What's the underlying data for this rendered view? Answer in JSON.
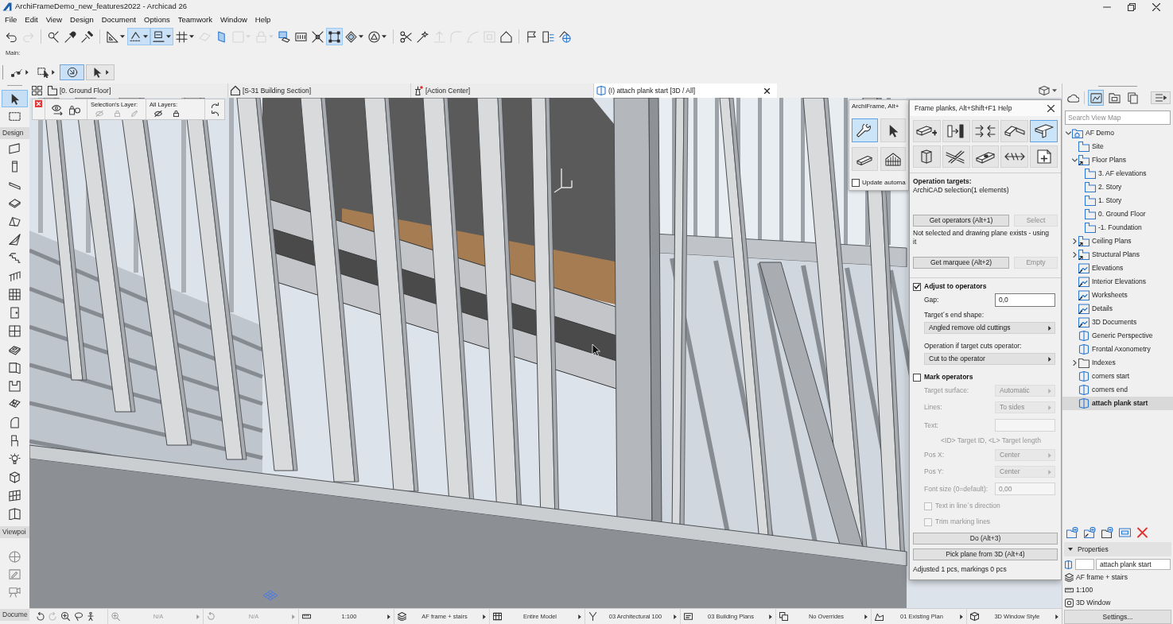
{
  "window": {
    "title": "ArchiFrameDemo_new_features2022 - Archicad 26"
  },
  "menu": [
    "File",
    "Edit",
    "View",
    "Design",
    "Document",
    "Options",
    "Teamwork",
    "Window",
    "Help"
  ],
  "toolbar": [
    {
      "selected": false,
      "disabled": false
    },
    {
      "selected": false,
      "disabled": true
    },
    {
      "selected": false,
      "disabled": false
    },
    {
      "selected": false,
      "disabled": false
    },
    {
      "selected": false,
      "disabled": false
    },
    {
      "selected": false,
      "disabled": false
    },
    {
      "selected": true,
      "disabled": false
    },
    {
      "selected": true,
      "disabled": false
    },
    {
      "selected": false,
      "disabled": false
    },
    {
      "selected": false,
      "disabled": true
    },
    {
      "selected": false,
      "disabled": false
    },
    {
      "selected": false,
      "disabled": true
    },
    {
      "selected": false,
      "disabled": true
    },
    {
      "selected": false,
      "disabled": false
    },
    {
      "selected": false,
      "disabled": false
    },
    {
      "selected": false,
      "disabled": false
    },
    {
      "selected": true,
      "disabled": false
    },
    {
      "selected": false,
      "disabled": false
    },
    {
      "selected": false,
      "disabled": false
    },
    {
      "selected": false,
      "disabled": false
    },
    {
      "selected": false,
      "disabled": false
    },
    {
      "selected": false,
      "disabled": true
    },
    {
      "selected": false,
      "disabled": true
    },
    {
      "selected": false,
      "disabled": true
    },
    {
      "selected": false,
      "disabled": true
    },
    {
      "selected": false,
      "disabled": false
    },
    {
      "selected": false,
      "disabled": false
    },
    {
      "selected": false,
      "disabled": false
    },
    {
      "selected": false,
      "disabled": false
    }
  ],
  "secondary_toolbar": {
    "label": "Main:",
    "buttons": [
      {
        "selected": false
      },
      {
        "selected": false
      },
      {
        "selected": true
      },
      {
        "selected": false
      }
    ]
  },
  "toolbox": {
    "top_tools": [
      {
        "selected": true
      },
      {
        "selected": false
      }
    ],
    "sections": [
      {
        "label": "Design",
        "tools": [
          {
            "selected": false
          },
          {
            "selected": false
          },
          {
            "selected": false
          },
          {
            "selected": false
          },
          {
            "selected": false
          },
          {
            "selected": false
          },
          {
            "selected": false
          },
          {
            "selected": false
          },
          {
            "selected": false
          },
          {
            "selected": false
          },
          {
            "selected": false
          },
          {
            "selected": false
          },
          {
            "selected": false
          },
          {
            "selected": false
          },
          {
            "selected": false
          },
          {
            "selected": false
          },
          {
            "selected": false
          },
          {
            "selected": false
          },
          {
            "selected": false
          },
          {
            "selected": false
          },
          {
            "selected": false
          }
        ]
      },
      {
        "label": "Viewpoi",
        "tools": [
          {
            "selected": false
          },
          {
            "selected": false
          },
          {
            "selected": false
          }
        ]
      },
      {
        "label": "Docume"
      }
    ]
  },
  "tabs": [
    {
      "kind": "plan",
      "label": "[0. Ground Floor]",
      "selected": false
    },
    {
      "kind": "section",
      "label": "[S-31 Building Section]",
      "selected": false
    },
    {
      "kind": "action",
      "label": "[Action Center]",
      "selected": false
    },
    {
      "kind": "model",
      "label": "(I) attach plank start [3D / All]",
      "selected": true
    }
  ],
  "layer_palette": {
    "selection_layer_label": "Selection's Layer:",
    "all_layers_label": "All Layers:"
  },
  "archiframe_palette": {
    "title": "ArchiFrame, Alt+",
    "tools": [
      {
        "selected": true
      },
      {
        "selected": false
      },
      {
        "selected": false
      },
      {
        "selected": false
      }
    ],
    "update_label": "Update automa",
    "update_checked": false
  },
  "frame_planks_dialog": {
    "title": "Frame planks, Alt+Shift+F1 Help",
    "tools": [
      {
        "selected": false
      },
      {
        "selected": false
      },
      {
        "selected": false
      },
      {
        "selected": false
      },
      {
        "selected": true
      },
      {
        "selected": false
      },
      {
        "selected": false
      },
      {
        "selected": false
      },
      {
        "selected": false
      },
      {
        "selected": false
      }
    ],
    "operation_targets_label": "Operation targets:",
    "operation_targets_value": "ArchiCAD selection(1 elements)",
    "target_buttons": [
      {
        "label": "Get operators (Alt+1)",
        "disabled": false
      },
      {
        "label": "Select",
        "disabled": true
      }
    ],
    "operators_status": "Not selected and drawing plane exists - using it",
    "marquee_buttons": [
      {
        "label": "Get marquee (Alt+2)",
        "disabled": false
      },
      {
        "label": "Empty",
        "disabled": true
      }
    ],
    "adjust": {
      "label": "Adjust to operators",
      "checked": true,
      "gap_label": "Gap:",
      "gap_value": "0,0",
      "end_shape_label": "Target´s end shape:",
      "end_shape_value": "Angled remove old cuttings",
      "cut_label": "Operation if target cuts operator:",
      "cut_value": "Cut to the operator"
    },
    "mark": {
      "label": "Mark operators",
      "checked": false,
      "fields": [
        {
          "kind": "dropdown",
          "label": "Target surface:",
          "value": "Automatic",
          "disabled": true
        },
        {
          "kind": "dropdown",
          "label": "Lines:",
          "value": "To sides",
          "disabled": true
        },
        {
          "kind": "input",
          "label": "Text:",
          "disabled": true
        },
        {
          "kind": "note",
          "label": "<ID> Target ID, <L> Target length",
          "disabled": true
        },
        {
          "kind": "dropdown",
          "label": "Pos X:",
          "value": "Center",
          "disabled": true
        },
        {
          "kind": "dropdown",
          "label": "Pos Y:",
          "value": "Center",
          "disabled": true
        },
        {
          "kind": "input",
          "label": "Font size (0=default):",
          "value": "0,00",
          "disabled": true
        },
        {
          "kind": "checkbox",
          "label": "Text in line´s direction",
          "checked": false,
          "disabled": true
        },
        {
          "kind": "checkbox",
          "label": "Trim marking lines",
          "checked": false,
          "disabled": true
        }
      ]
    },
    "do_button": "Do (Alt+3)",
    "pick_button": "Pick plane from 3D (Alt+4)",
    "result": "Adjusted 1 pcs, markings 0 pcs"
  },
  "navigator": {
    "modes": [
      {
        "selected": false
      },
      {
        "selected": true
      },
      {
        "selected": false
      },
      {
        "selected": false
      }
    ],
    "search": {
      "placeholder": "Search View Map"
    },
    "tree": [
      {
        "kind": "project",
        "label": "AF Demo",
        "expanded": true,
        "selected": false,
        "children": [
          {
            "kind": "view",
            "label": "Site",
            "selected": false
          },
          {
            "kind": "planset",
            "label": "Floor Plans",
            "expanded": true,
            "selected": false,
            "children": [
              {
                "kind": "story",
                "label": "3. AF elevations",
                "selected": false
              },
              {
                "kind": "story",
                "label": "2. Story",
                "selected": false
              },
              {
                "kind": "story",
                "label": "1. Story",
                "selected": false
              },
              {
                "kind": "story",
                "label": "0. Ground Floor",
                "selected": false
              },
              {
                "kind": "story",
                "label": "-1. Foundation",
                "selected": false
              }
            ]
          },
          {
            "kind": "planset",
            "label": "Ceiling Plans",
            "expanded": false,
            "selected": false
          },
          {
            "kind": "planset",
            "label": "Structural Plans",
            "expanded": false,
            "selected": false
          },
          {
            "kind": "viewset",
            "label": "Elevations",
            "selected": false
          },
          {
            "kind": "viewset",
            "label": "Interior Elevations",
            "selected": false
          },
          {
            "kind": "viewset",
            "label": "Worksheets",
            "selected": false
          },
          {
            "kind": "viewset",
            "label": "Details",
            "selected": false
          },
          {
            "kind": "viewset",
            "label": "3D Documents",
            "selected": false
          },
          {
            "kind": "model",
            "label": "Generic Perspective",
            "selected": false
          },
          {
            "kind": "model",
            "label": "Frontal Axonometry",
            "selected": false
          },
          {
            "kind": "folder",
            "label": "Indexes",
            "expanded": false,
            "selected": false
          },
          {
            "kind": "model",
            "label": "corners start",
            "selected": false
          },
          {
            "kind": "model",
            "label": "corners end",
            "selected": false
          },
          {
            "kind": "model",
            "label": "attach plank start",
            "selected": true
          }
        ]
      }
    ],
    "properties": {
      "title": "Properties",
      "expanded": true,
      "name": "attach plank start",
      "layer_combination": "AF frame + stairs",
      "scale": "1:100",
      "view_type": "3D Window",
      "settings_button": "Settings..."
    }
  },
  "status_bar": {
    "items": [
      {
        "value": "N/A",
        "disabled": true
      },
      {
        "value": "N/A",
        "disabled": true
      },
      {
        "value": "1:100",
        "disabled": false
      },
      {
        "value": "AF frame + stairs",
        "disabled": false
      },
      {
        "value": "Entire Model",
        "disabled": false
      },
      {
        "value": "03 Architectural 100",
        "disabled": false
      },
      {
        "value": "03 Building Plans",
        "disabled": false
      },
      {
        "value": "No Overrides",
        "disabled": false
      },
      {
        "value": "01 Existing Plan",
        "disabled": false
      },
      {
        "value": "3D Window Style",
        "disabled": false
      }
    ]
  }
}
